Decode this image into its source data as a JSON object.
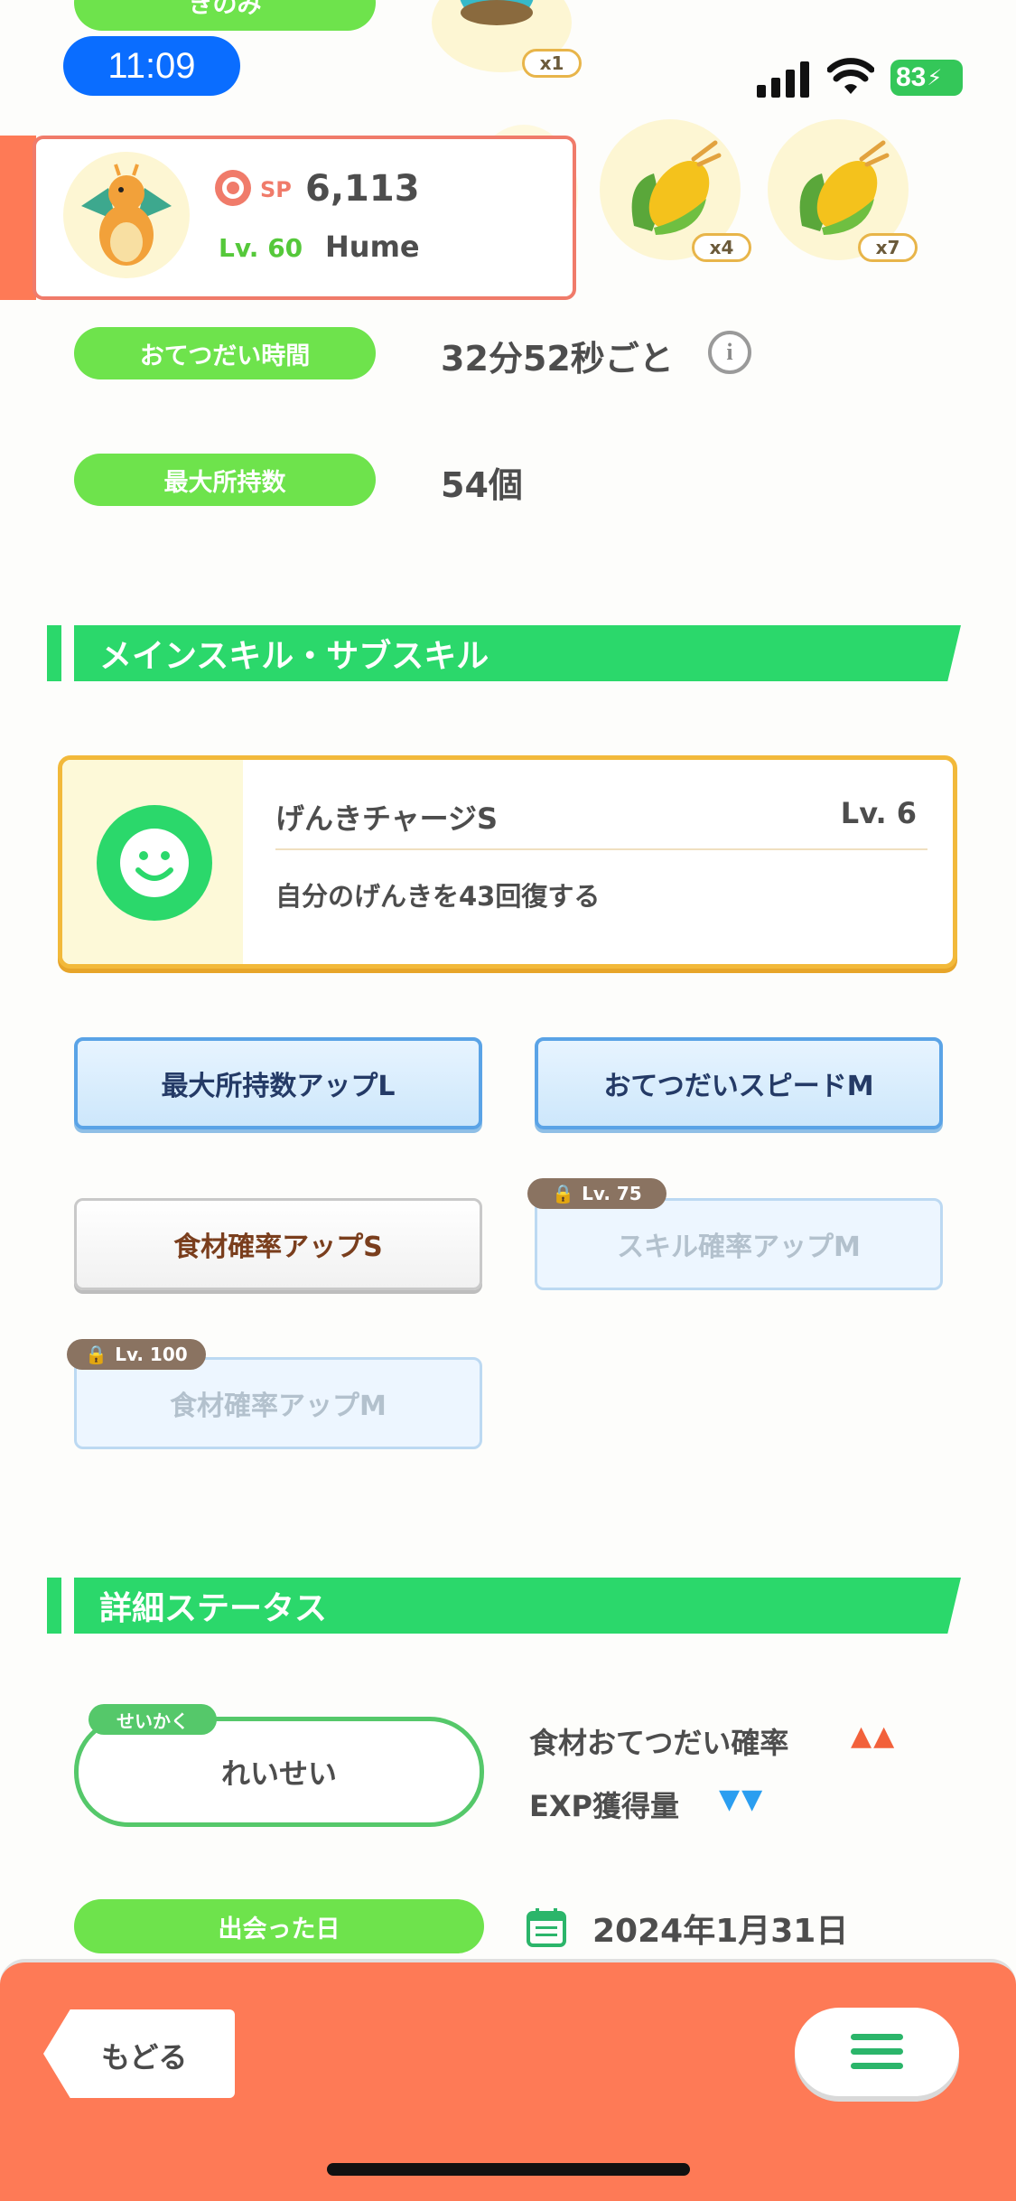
{
  "status_bar": {
    "time": "11:09",
    "battery": "83"
  },
  "top": {
    "partial_label": "きのみ",
    "berry_counts": [
      "x1",
      "x4",
      "x7"
    ]
  },
  "pokemon_card": {
    "sp_label": "SP",
    "sp_value": "6,113",
    "level": "Lv. 60",
    "name": "Hume"
  },
  "stats": {
    "help_time_label": "おてつだい時間",
    "help_time_value": "32分52秒ごと",
    "max_carry_label": "最大所持数",
    "max_carry_value": "54個"
  },
  "skills_section": {
    "title": "メインスキル・サブスキル",
    "main_skill": {
      "name": "げんきチャージS",
      "level": "Lv. 6",
      "description": "自分のげんきを43回復する"
    },
    "sub_skills": [
      {
        "label": "最大所持数アップL"
      },
      {
        "label": "おてつだいスピードM"
      },
      {
        "label": "食材確率アップS"
      },
      {
        "label": "スキル確率アップM",
        "lock": "Lv. 75"
      },
      {
        "label": "食材確率アップM",
        "lock": "Lv. 100"
      }
    ]
  },
  "detail_section": {
    "title": "詳細ステータス",
    "nature_tag": "せいかく",
    "nature_value": "れいせい",
    "nature_effects": [
      {
        "label": "食材おてつだい確率",
        "arrows": "▲▲",
        "color": "#f2613b"
      },
      {
        "label": "EXP獲得量",
        "arrows": "▼▼",
        "color": "#2b9ef0"
      }
    ],
    "met_date_label": "出会った日",
    "met_date_value": "2024年1月31日"
  },
  "bottom_bar": {
    "back_label": "もどる",
    "accent": "#fe7a56"
  }
}
